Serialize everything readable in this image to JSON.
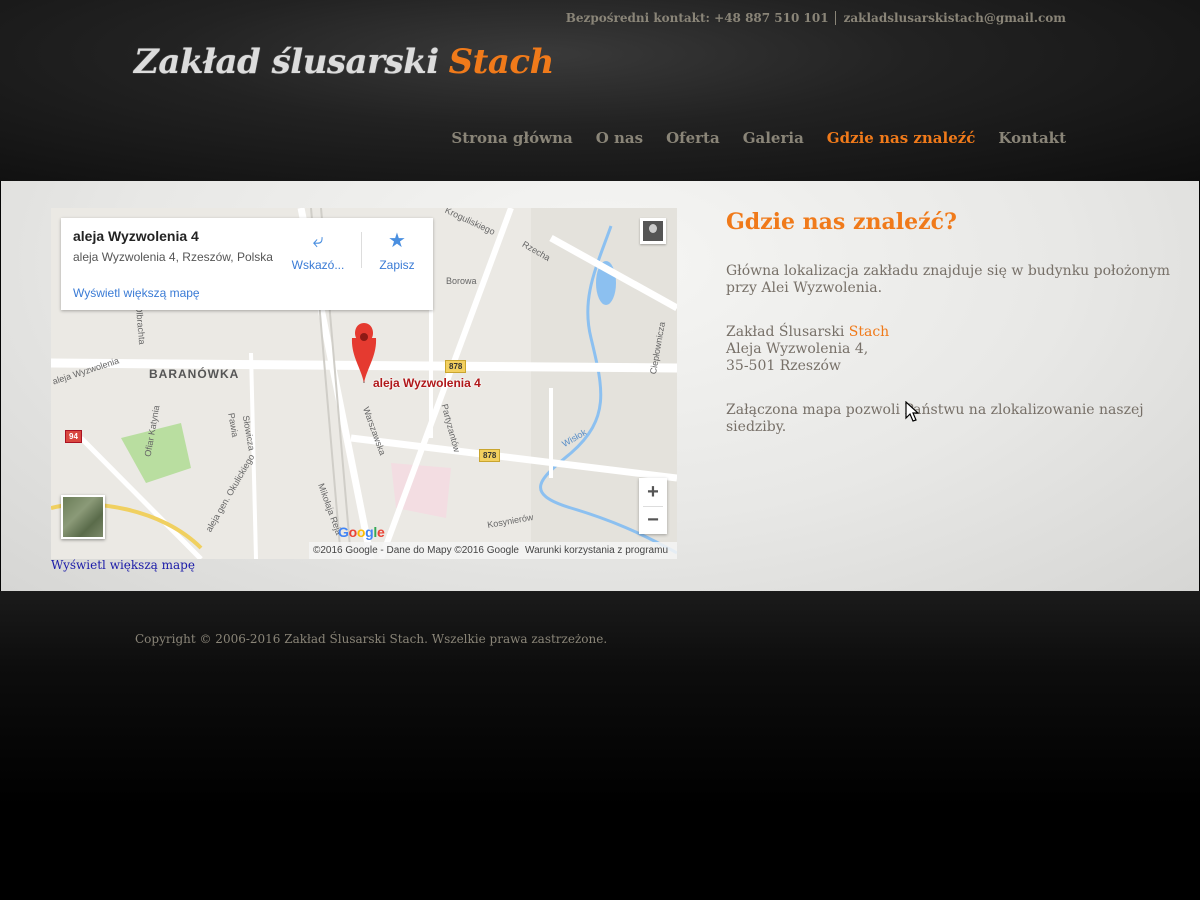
{
  "header": {
    "contact_label": "Bezpośredni kontakt: +48 887 510 101",
    "email": "zakladslusarskistach@gmail.com",
    "logo_main": "Zakład ślusarski",
    "logo_accent": "Stach"
  },
  "nav": {
    "items": [
      {
        "label": "Strona główna"
      },
      {
        "label": "O nas"
      },
      {
        "label": "Oferta"
      },
      {
        "label": "Galeria"
      },
      {
        "label": "Gdzie nas znaleźć",
        "active": true
      },
      {
        "label": "Kontakt"
      }
    ]
  },
  "map": {
    "card_title": "aleja Wyzwolenia 4",
    "card_address": "aleja Wyzwolenia 4, Rzeszów, Polska",
    "card_bigger_link": "Wyświetl większą mapę",
    "directions_label": "Wskazó...",
    "save_label": "Zapisz",
    "pin_label": "aleja Wyzwolenia 4",
    "district_label": "BARANÓWKA",
    "labels": {
      "borowa": "Borowa",
      "rzecha": "Rzecha",
      "kroguliskiego": "Kroguliskiego",
      "olbrachta": "Olbrachta",
      "aleja_wyzwolenia": "aleja Wyzwolenia",
      "warszawska": "Warszawska",
      "partyzantow": "Partyzantów",
      "wislok": "Wisłok",
      "ciepłownicza": "Ciepłownicza",
      "ofiar_katynia": "Ofiar Katynia",
      "pawia": "Pawia",
      "slowicza": "Słowicza",
      "okulickiego": "aleja gen. Okulickiego",
      "mikolaja_reja": "Mikołaja Reja",
      "kosynierow": "Kosynierów"
    },
    "shields": {
      "route_878": "878",
      "route_94": "94"
    },
    "zoom_in": "+",
    "zoom_out": "−",
    "google": "Google",
    "attribution": "©2016 Google - Dane do Mapy ©2016 Google",
    "terms": "Warunki korzystania z programu",
    "below_link": "Wyświetl większą mapę"
  },
  "content": {
    "title": "Gdzie nas znaleźć?",
    "para1": "Główna lokalizacja zakładu znajduje się w budynku położonym przy Alei Wyzwolenia.",
    "company_prefix": "Zakład Ślusarski ",
    "company_accent": "Stach",
    "address_line1": "Aleja Wyzwolenia 4,",
    "address_line2": "35-501 Rzeszów",
    "para3": "Załączona mapa pozwoli Państwu na zlokalizowanie naszej siedziby."
  },
  "footer": {
    "copyright": "Copyright © 2006-2016 Zakład Ślusarski Stach. Wszelkie prawa zastrzeżone."
  },
  "colors": {
    "accent": "#f07a1a",
    "nav_text": "#8a8578",
    "body_text": "#777068"
  }
}
